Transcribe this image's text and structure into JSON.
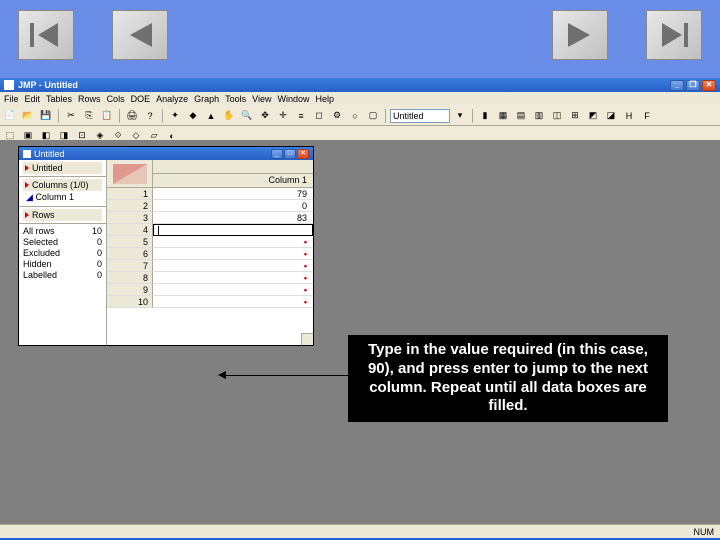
{
  "nav": {
    "first": "first",
    "prev": "prev",
    "next": "next",
    "last": "last"
  },
  "app": {
    "title": "JMP - Untitled",
    "menu": [
      "File",
      "Edit",
      "Tables",
      "Rows",
      "Cols",
      "DOE",
      "Analyze",
      "Graph",
      "Tools",
      "View",
      "Window",
      "Help"
    ],
    "toolbar_field": "Untitled"
  },
  "data_window": {
    "title": "Untitled",
    "left": {
      "panel1": "Untitled",
      "columns_label": "Columns (1/0)",
      "column1": "Column 1",
      "rows_label": "Rows",
      "stats": [
        {
          "label": "All rows",
          "value": "10"
        },
        {
          "label": "Selected",
          "value": "0"
        },
        {
          "label": "Excluded",
          "value": "0"
        },
        {
          "label": "Hidden",
          "value": "0"
        },
        {
          "label": "Labelled",
          "value": "0"
        }
      ]
    },
    "grid": {
      "col_header": "Column 1",
      "rows": [
        {
          "n": "1",
          "v": "79"
        },
        {
          "n": "2",
          "v": "0"
        },
        {
          "n": "3",
          "v": "83"
        },
        {
          "n": "4",
          "v": "",
          "editing": true
        },
        {
          "n": "5",
          "v": "•"
        },
        {
          "n": "6",
          "v": "•"
        },
        {
          "n": "7",
          "v": "•"
        },
        {
          "n": "8",
          "v": "•"
        },
        {
          "n": "9",
          "v": "•"
        },
        {
          "n": "10",
          "v": "•"
        }
      ]
    }
  },
  "callout": "Type in the value required (in this case, 90), and press enter to jump to the next column. Repeat until all data boxes are filled.",
  "status": "NUM"
}
